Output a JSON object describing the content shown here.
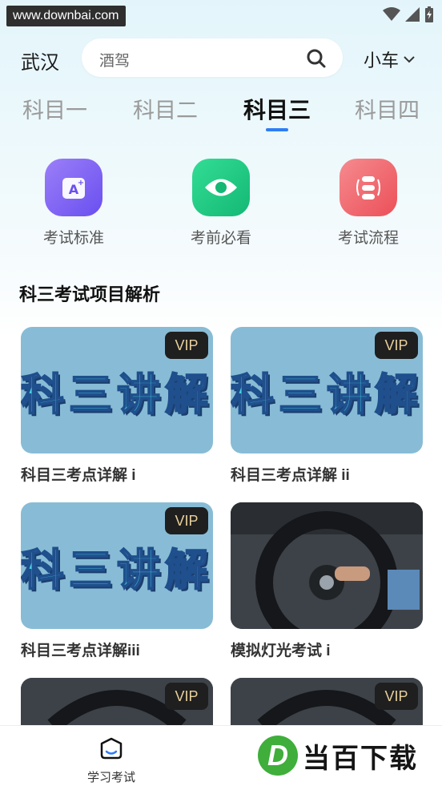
{
  "status": {
    "watermark": "www.downbai.com"
  },
  "header": {
    "city": "武汉",
    "search_placeholder": "酒驾",
    "vehicle": "小车"
  },
  "tabs": [
    {
      "label": "科目一"
    },
    {
      "label": "科目二"
    },
    {
      "label": "科目三",
      "active": true
    },
    {
      "label": "科目四"
    }
  ],
  "quick_actions": [
    {
      "label": "考试标准",
      "icon": "exam-standard-icon",
      "color": "#7f63f2"
    },
    {
      "label": "考前必看",
      "icon": "eye-icon",
      "color": "#1fcf86"
    },
    {
      "label": "考试流程",
      "icon": "exam-process-icon",
      "color": "#f05b62"
    }
  ],
  "section": {
    "title": "科三考试项目解析"
  },
  "cards": [
    {
      "title": "科目三考点详解 i",
      "thumb_text": "科三讲解",
      "vip": "VIP"
    },
    {
      "title": "科目三考点详解 ii",
      "thumb_text": "科三讲解",
      "vip": "VIP"
    },
    {
      "title": "科目三考点详解iii",
      "thumb_text": "科三讲解",
      "vip": "VIP"
    },
    {
      "title": "模拟灯光考试 i",
      "thumb_text": "",
      "vip": ""
    },
    {
      "title": "",
      "thumb_text": "",
      "vip": "VIP"
    },
    {
      "title": "",
      "thumb_text": "",
      "vip": "VIP"
    }
  ],
  "bottom_nav": {
    "study_label": "学习考试"
  },
  "footer_logo": {
    "text": "当百下载",
    "mark": "D"
  }
}
